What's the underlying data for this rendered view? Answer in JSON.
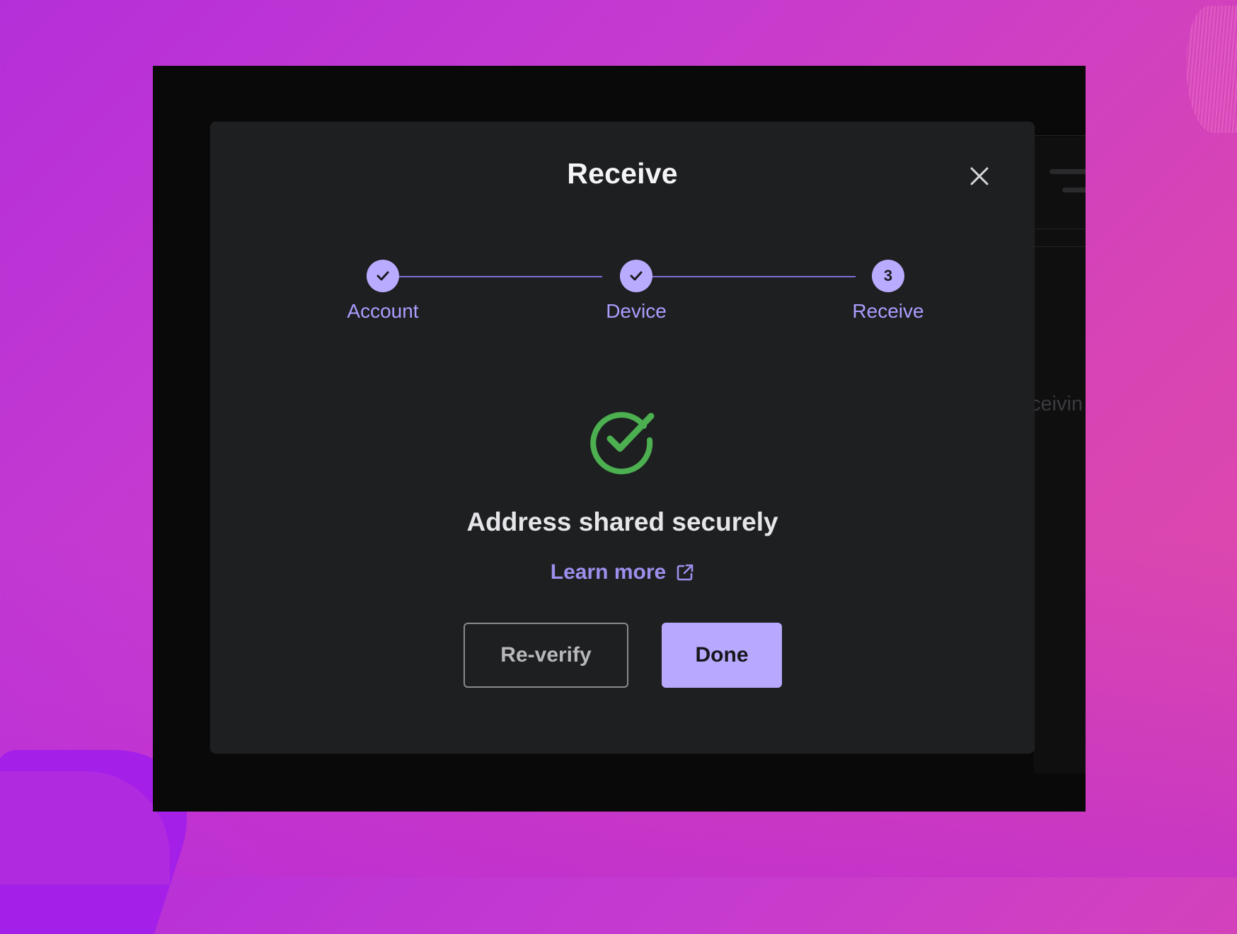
{
  "modal": {
    "title": "Receive",
    "close_icon": "close-icon"
  },
  "stepper": {
    "steps": [
      {
        "label": "Account",
        "state": "complete",
        "marker": "check-icon"
      },
      {
        "label": "Device",
        "state": "complete",
        "marker": "check-icon"
      },
      {
        "label": "Receive",
        "state": "current",
        "marker": "3"
      }
    ]
  },
  "status": {
    "icon": "check-circle-icon",
    "title": "Address shared securely",
    "learn_more_label": "Learn more",
    "learn_more_icon": "external-link-icon"
  },
  "actions": {
    "reverify_label": "Re-verify",
    "done_label": "Done"
  },
  "background": {
    "partial_text": "ceivin"
  },
  "colors": {
    "accent": "#b8a9ff",
    "success": "#4caf50",
    "modal_bg": "#1e1f21"
  }
}
